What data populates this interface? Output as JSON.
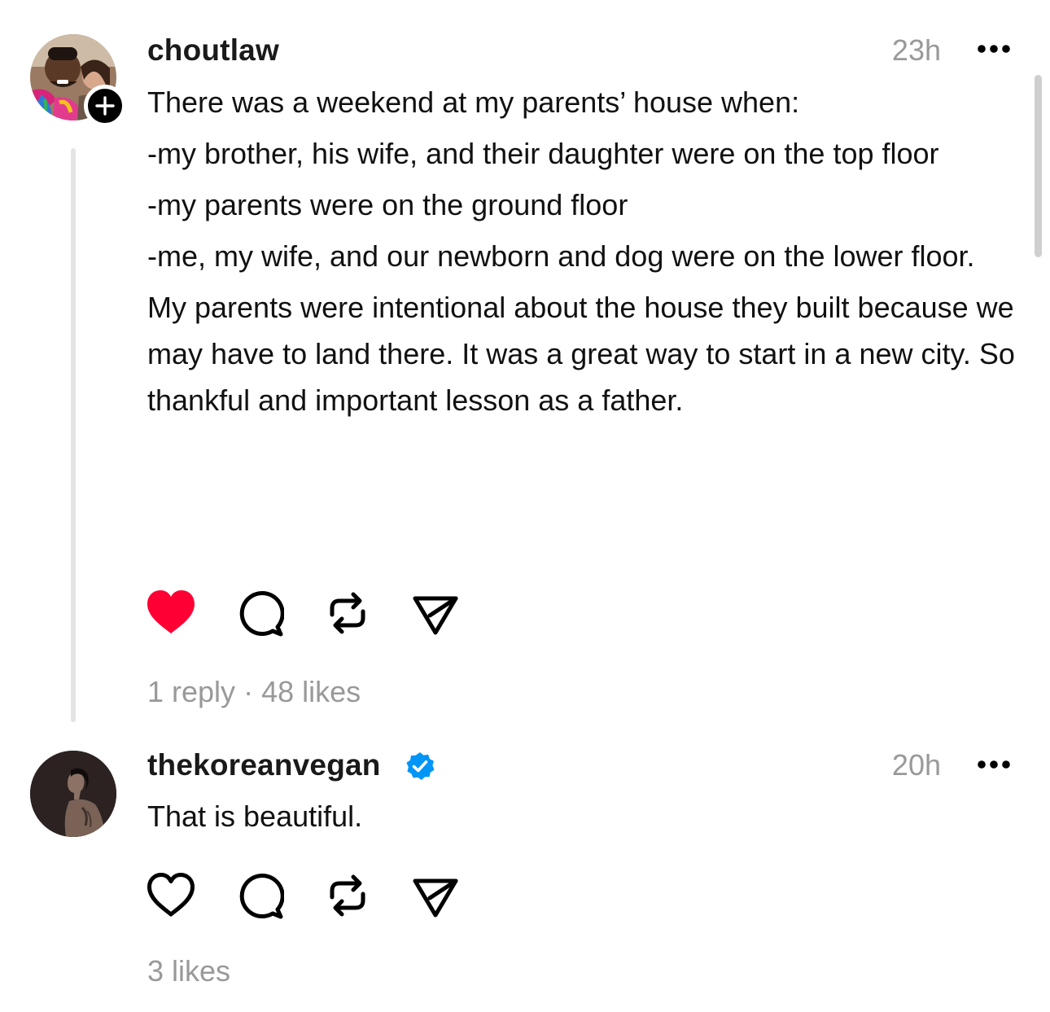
{
  "posts": [
    {
      "username": "choutlaw",
      "time": "23h",
      "paragraphs": [
        "There was a weekend at my parents’ house when:",
        "-my brother, his wife, and their daughter were on the top floor",
        "-my parents were on the ground floor",
        "-me, my wife, and our newborn and dog were on the lower floor.",
        "My parents were intentional about the house they built because we may have to land there. It was a great way to start in a new city. So thankful and important lesson as a father."
      ],
      "liked": true,
      "replies_label": "1 reply",
      "separator": " · ",
      "likes_label": "48 likes",
      "icons": [
        "heart-filled-icon",
        "comment-icon",
        "repost-icon",
        "share-icon"
      ]
    },
    {
      "username": "thekoreanvegan",
      "verified": true,
      "time": "20h",
      "paragraphs": [
        "That is beautiful."
      ],
      "liked": false,
      "likes_label": "3 likes",
      "icons": [
        "heart-outline-icon",
        "comment-icon",
        "repost-icon",
        "share-icon"
      ]
    }
  ],
  "colors": {
    "like_red": "#ff0034",
    "verified_blue": "#0095f6",
    "muted_text": "#999999"
  }
}
